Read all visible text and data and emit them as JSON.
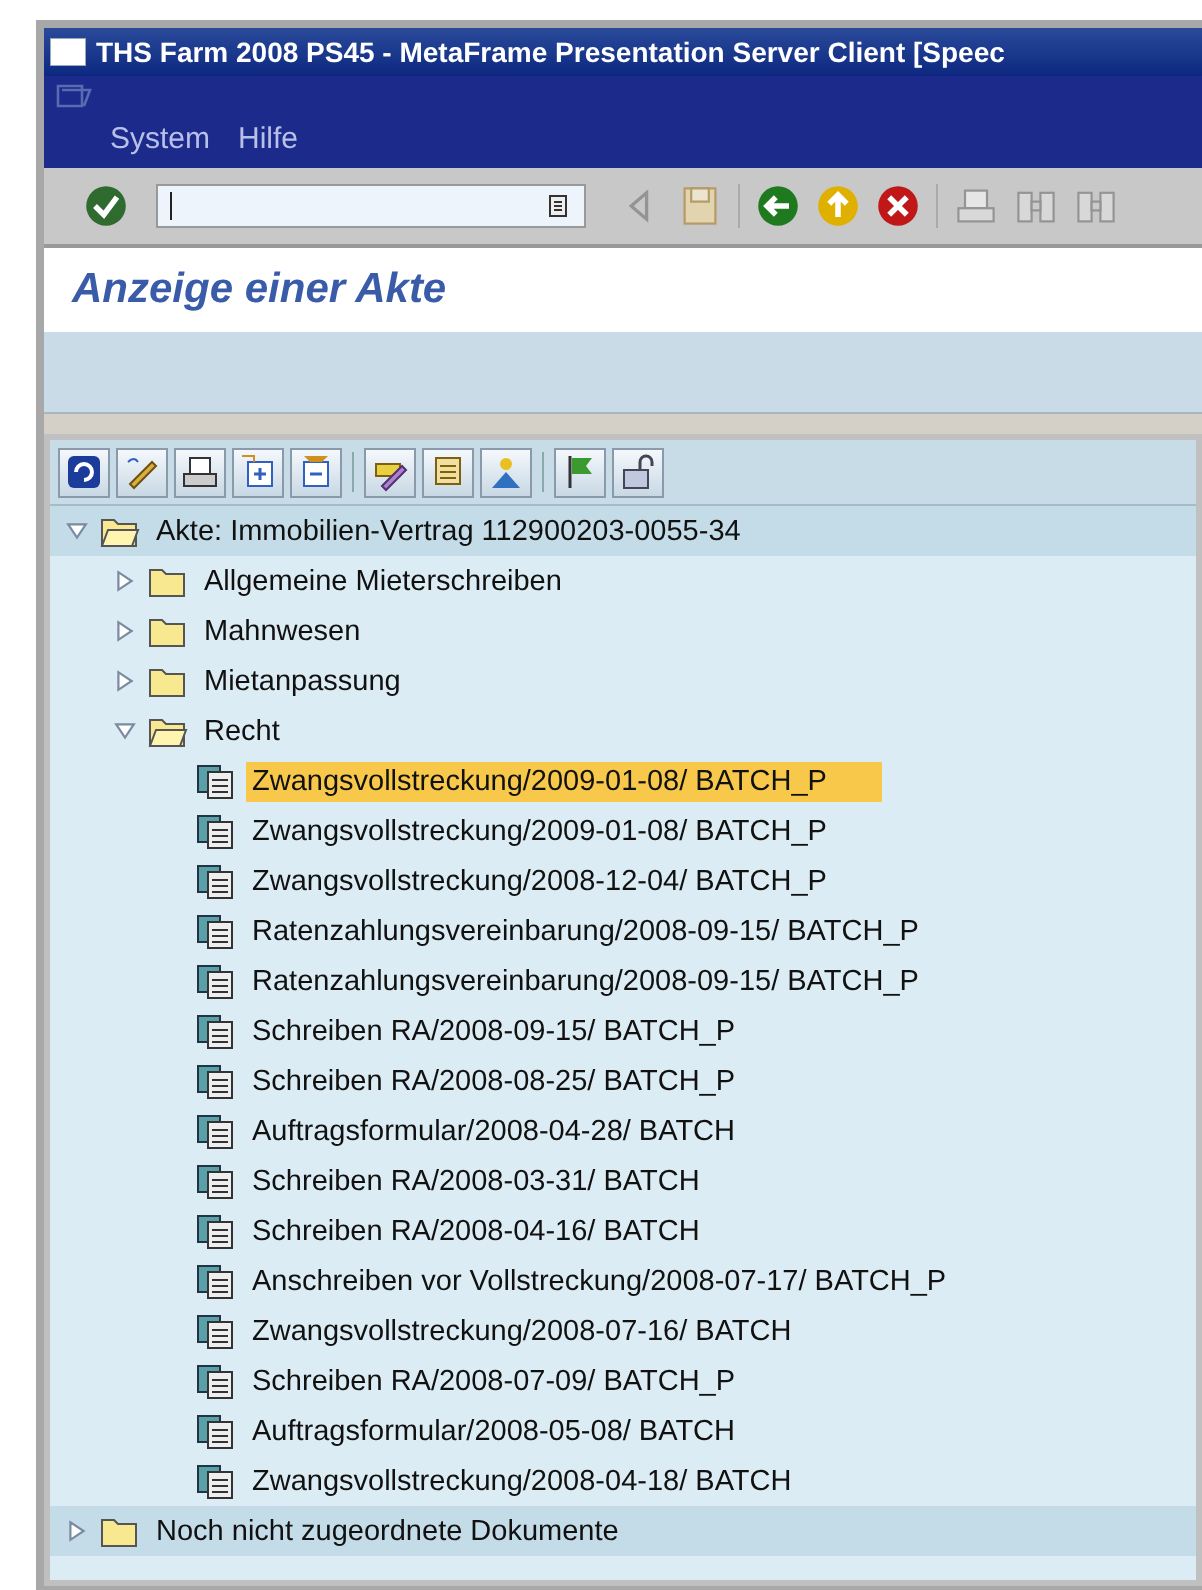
{
  "window": {
    "title": "THS Farm 2008 PS45 - MetaFrame Presentation Server Client [Speec"
  },
  "menu": [
    "System",
    "Hilfe"
  ],
  "header": {
    "title": "Anzeige einer Akte"
  },
  "tree": [
    {
      "kind": "folder",
      "label": "Akte: Immobilien-Vertrag 112900203-0055-34",
      "expanded": true,
      "selected": false,
      "children": [
        {
          "kind": "folder",
          "label": "Allgemeine Mieterschreiben",
          "expanded": false,
          "selected": false
        },
        {
          "kind": "folder",
          "label": "Mahnwesen",
          "expanded": false,
          "selected": false
        },
        {
          "kind": "folder",
          "label": "Mietanpassung",
          "expanded": false,
          "selected": false
        },
        {
          "kind": "folder",
          "label": "Recht",
          "expanded": true,
          "selected": false,
          "children": [
            {
              "kind": "document",
              "label": "Zwangsvollstreckung/2009-01-08/ BATCH_P",
              "selected": true
            },
            {
              "kind": "document",
              "label": "Zwangsvollstreckung/2009-01-08/ BATCH_P",
              "selected": false
            },
            {
              "kind": "document",
              "label": "Zwangsvollstreckung/2008-12-04/ BATCH_P",
              "selected": false
            },
            {
              "kind": "document",
              "label": "Ratenzahlungsvereinbarung/2008-09-15/ BATCH_P",
              "selected": false
            },
            {
              "kind": "document",
              "label": "Ratenzahlungsvereinbarung/2008-09-15/ BATCH_P",
              "selected": false
            },
            {
              "kind": "document",
              "label": "Schreiben RA/2008-09-15/ BATCH_P",
              "selected": false
            },
            {
              "kind": "document",
              "label": "Schreiben RA/2008-08-25/ BATCH_P",
              "selected": false
            },
            {
              "kind": "document",
              "label": "Auftragsformular/2008-04-28/ BATCH",
              "selected": false
            },
            {
              "kind": "document",
              "label": "Schreiben RA/2008-03-31/ BATCH",
              "selected": false
            },
            {
              "kind": "document",
              "label": "Schreiben RA/2008-04-16/ BATCH",
              "selected": false
            },
            {
              "kind": "document",
              "label": "Anschreiben vor Vollstreckung/2008-07-17/ BATCH_P",
              "selected": false
            },
            {
              "kind": "document",
              "label": "Zwangsvollstreckung/2008-07-16/ BATCH",
              "selected": false
            },
            {
              "kind": "document",
              "label": "Schreiben RA/2008-07-09/ BATCH_P",
              "selected": false
            },
            {
              "kind": "document",
              "label": "Auftragsformular/2008-05-08/ BATCH",
              "selected": false
            },
            {
              "kind": "document",
              "label": "Zwangsvollstreckung/2008-04-18/ BATCH",
              "selected": false
            }
          ]
        }
      ]
    },
    {
      "kind": "folder",
      "label": "Noch nicht zugeordnete Dokumente",
      "expanded": false,
      "selected": false
    }
  ]
}
